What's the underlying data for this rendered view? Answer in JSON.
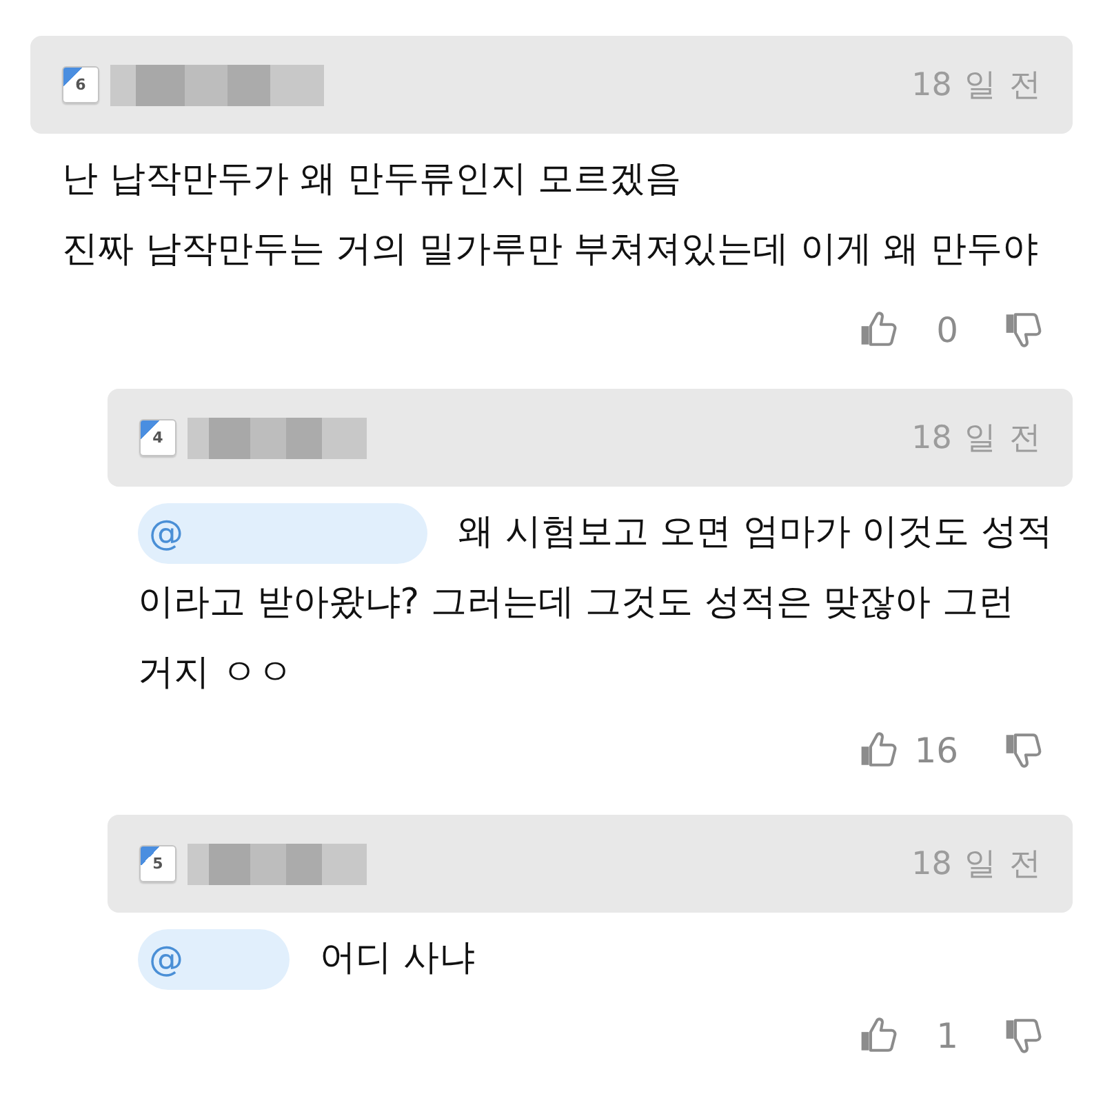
{
  "comments": [
    {
      "badge": "6",
      "time": "18 일 전",
      "body": [
        "난 납작만두가 왜 만두류인지 모르겠음",
        "진짜 남작만두는 거의 밀가루만 부쳐져있는데 이게 왜 만두야"
      ],
      "likes": "0",
      "replies": [
        {
          "badge": "4",
          "time": "18 일 전",
          "mention": "@",
          "text": "왜 시험보고 오면 엄마가 이것도 성적이라고 받아왔냐? 그러는데 그것도 성적은 맞잖아 그런 거지 ㅇㅇ",
          "likes": "16"
        },
        {
          "badge": "5",
          "time": "18 일 전",
          "mention": "@",
          "text": "어디 사냐",
          "likes": "1"
        }
      ]
    }
  ]
}
